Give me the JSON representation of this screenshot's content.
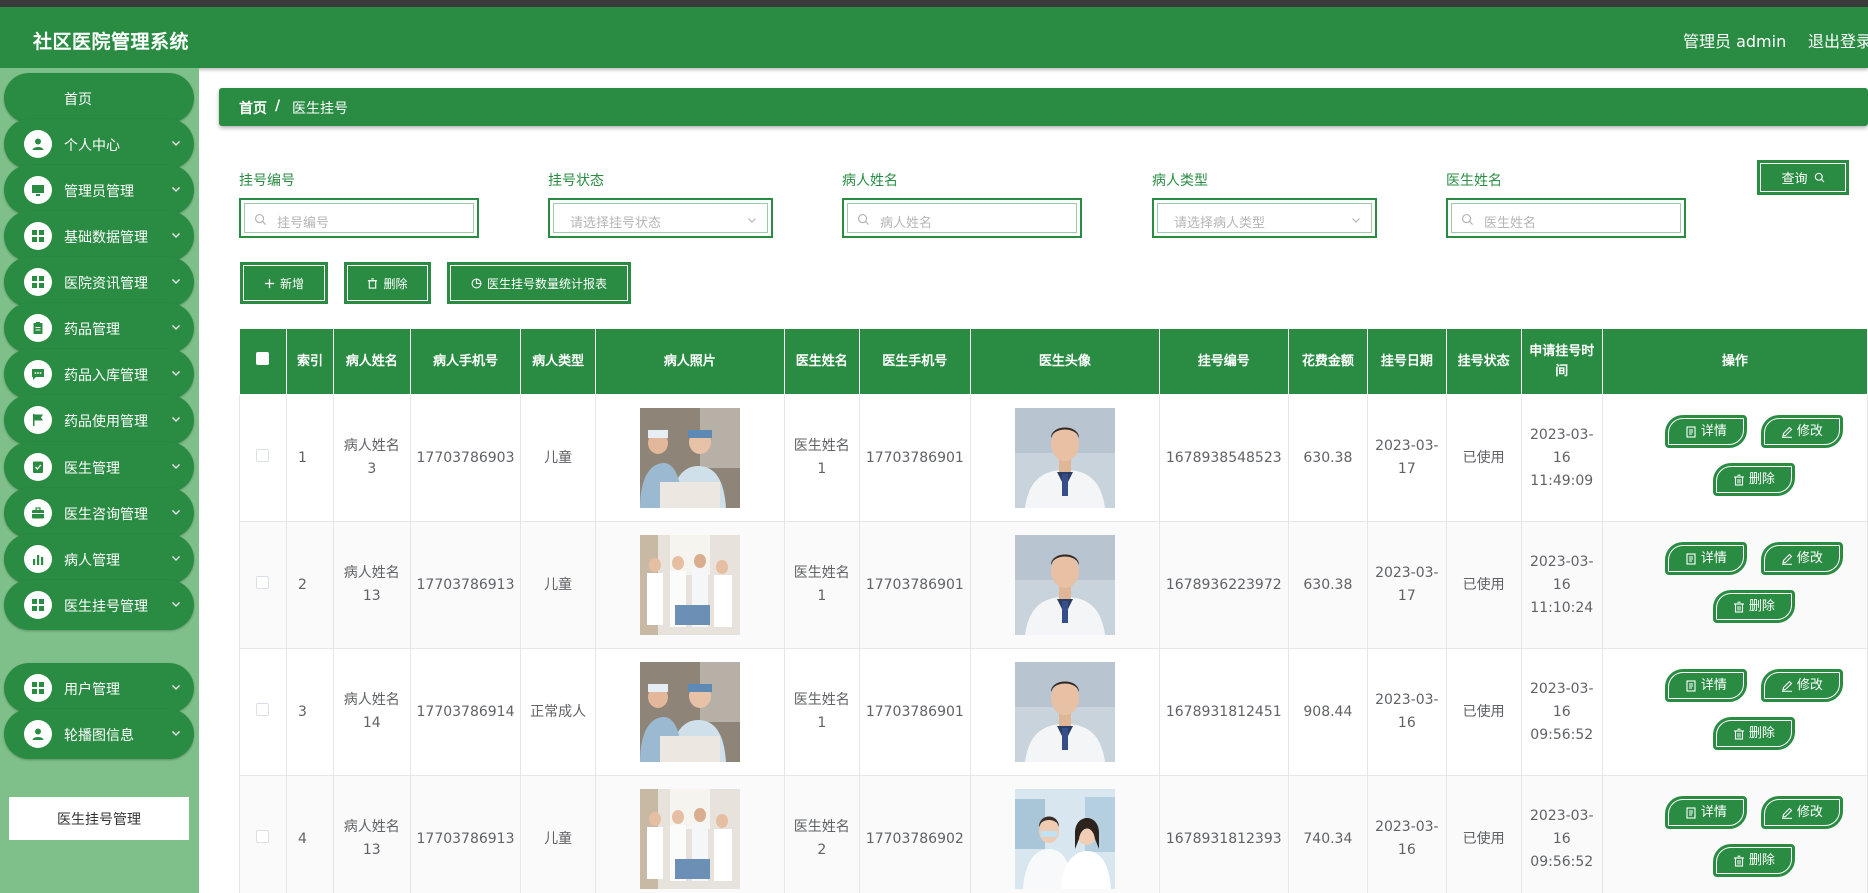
{
  "header": {
    "title": "社区医院管理系统",
    "admin": "管理员 admin",
    "logout": "退出登录"
  },
  "sidebar": {
    "home": "首页",
    "items": [
      {
        "label": "个人中心",
        "icon": "user-icon"
      },
      {
        "label": "管理员管理",
        "icon": "monitor-icon"
      },
      {
        "label": "基础数据管理",
        "icon": "grid-icon"
      },
      {
        "label": "医院资讯管理",
        "icon": "grid-icon"
      },
      {
        "label": "药品管理",
        "icon": "clipboard-icon"
      },
      {
        "label": "药品入库管理",
        "icon": "chat-icon"
      },
      {
        "label": "药品使用管理",
        "icon": "flag-icon"
      },
      {
        "label": "医生管理",
        "icon": "checklist-icon"
      },
      {
        "label": "医生咨询管理",
        "icon": "briefcase-icon"
      },
      {
        "label": "病人管理",
        "icon": "bar-chart-icon"
      },
      {
        "label": "医生挂号管理",
        "icon": "grid-icon"
      },
      {
        "label": "用户管理",
        "icon": "grid-icon"
      },
      {
        "label": "轮播图信息",
        "icon": "user-icon"
      }
    ],
    "active_sub": "医生挂号管理"
  },
  "breadcrumb": {
    "home": "首页",
    "sep": "/",
    "current": "医生挂号"
  },
  "filters": [
    {
      "label": "挂号编号",
      "placeholder": "挂号编号",
      "type": "input"
    },
    {
      "label": "挂号状态",
      "placeholder": "请选择挂号状态",
      "type": "select"
    },
    {
      "label": "病人姓名",
      "placeholder": "病人姓名",
      "type": "input"
    },
    {
      "label": "病人类型",
      "placeholder": "请选择病人类型",
      "type": "select"
    },
    {
      "label": "医生姓名",
      "placeholder": "医生姓名",
      "type": "input"
    }
  ],
  "actions": {
    "query": "查询",
    "add": "新增",
    "delete": "删除",
    "report": "医生挂号数量统计报表"
  },
  "table": {
    "columns": [
      "索引",
      "病人姓名",
      "病人手机号",
      "病人类型",
      "病人照片",
      "医生姓名",
      "医生手机号",
      "医生头像",
      "挂号编号",
      "花费金额",
      "挂号日期",
      "挂号状态",
      "申请挂号时间",
      "操作"
    ],
    "rows": [
      {
        "index": "1",
        "patient": "病人姓名3",
        "patient_phone": "17703786903",
        "patient_type": "儿童",
        "patient_photo": "nurses",
        "doctor": "医生姓名1",
        "doctor_phone": "17703786901",
        "doctor_photo": "doctor-male",
        "reg_no": "1678938548523",
        "fee": "630.38",
        "reg_date": "2023-03-17",
        "status": "已使用",
        "apply_time": "2023-03-16 11:49:09"
      },
      {
        "index": "2",
        "patient": "病人姓名13",
        "patient_phone": "17703786913",
        "patient_type": "儿童",
        "patient_photo": "ward",
        "doctor": "医生姓名1",
        "doctor_phone": "17703786901",
        "doctor_photo": "doctor-male",
        "reg_no": "1678936223972",
        "fee": "630.38",
        "reg_date": "2023-03-17",
        "status": "已使用",
        "apply_time": "2023-03-16 11:10:24"
      },
      {
        "index": "3",
        "patient": "病人姓名14",
        "patient_phone": "17703786914",
        "patient_type": "正常成人",
        "patient_photo": "nurses",
        "doctor": "医生姓名1",
        "doctor_phone": "17703786901",
        "doctor_photo": "doctor-male",
        "reg_no": "1678931812451",
        "fee": "908.44",
        "reg_date": "2023-03-16",
        "status": "已使用",
        "apply_time": "2023-03-16 09:56:52"
      },
      {
        "index": "4",
        "patient": "病人姓名13",
        "patient_phone": "17703786913",
        "patient_type": "儿童",
        "patient_photo": "ward",
        "doctor": "医生姓名2",
        "doctor_phone": "17703786902",
        "doctor_photo": "doctors-team",
        "reg_no": "1678931812393",
        "fee": "740.34",
        "reg_date": "2023-03-16",
        "status": "已使用",
        "apply_time": "2023-03-16 09:56:52"
      }
    ],
    "row_actions": {
      "detail": "详情",
      "edit": "修改",
      "delete": "删除"
    }
  },
  "colors": {
    "primary": "#2a8c43",
    "sidebar_bg": "#7fbf8a",
    "topbar": "#3a3a3a"
  }
}
